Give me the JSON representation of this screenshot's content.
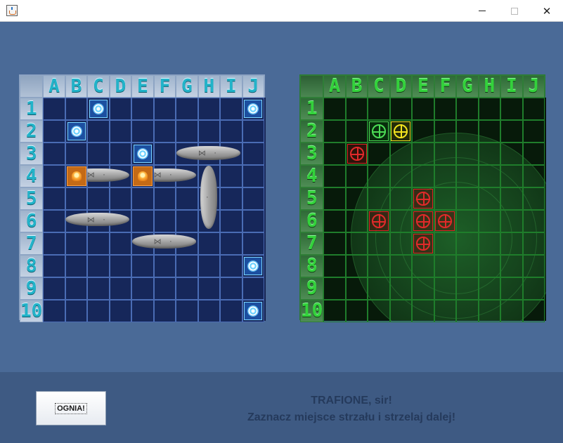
{
  "window": {
    "title": "",
    "icon": "java-cup-icon",
    "controls": {
      "minimize": "—",
      "maximize": "☐",
      "close": "✕"
    }
  },
  "player_board": {
    "columns": [
      "A",
      "B",
      "C",
      "D",
      "E",
      "F",
      "G",
      "H",
      "I",
      "J"
    ],
    "rows": [
      "1",
      "2",
      "3",
      "4",
      "5",
      "6",
      "7",
      "8",
      "9",
      "10"
    ],
    "misses": [
      {
        "col": "C",
        "row": 1
      },
      {
        "col": "J",
        "row": 1
      },
      {
        "col": "B",
        "row": 2
      },
      {
        "col": "E",
        "row": 3
      },
      {
        "col": "J",
        "row": 8
      },
      {
        "col": "J",
        "row": 10
      }
    ],
    "hits": [
      {
        "col": "B",
        "row": 4
      },
      {
        "col": "E",
        "row": 4
      }
    ],
    "ships": [
      {
        "start": "G3",
        "end": "I3",
        "orientation": "horizontal",
        "length": 3
      },
      {
        "start": "B4",
        "end": "D4",
        "orientation": "horizontal",
        "length": 3
      },
      {
        "start": "E4",
        "end": "G4",
        "orientation": "horizontal",
        "length": 3
      },
      {
        "start": "H4",
        "end": "H6",
        "orientation": "vertical",
        "length": 3
      },
      {
        "start": "B6",
        "end": "D6",
        "orientation": "horizontal",
        "length": 3
      },
      {
        "start": "E7",
        "end": "G7",
        "orientation": "horizontal",
        "length": 3
      }
    ]
  },
  "enemy_board": {
    "columns": [
      "A",
      "B",
      "C",
      "D",
      "E",
      "F",
      "G",
      "H",
      "I",
      "J"
    ],
    "rows": [
      "1",
      "2",
      "3",
      "4",
      "5",
      "6",
      "7",
      "8",
      "9",
      "10"
    ],
    "shots": [
      {
        "col": "C",
        "row": 2,
        "state": "green"
      },
      {
        "col": "D",
        "row": 2,
        "state": "yellow"
      },
      {
        "col": "B",
        "row": 3,
        "state": "red"
      },
      {
        "col": "E",
        "row": 5,
        "state": "red"
      },
      {
        "col": "C",
        "row": 6,
        "state": "red"
      },
      {
        "col": "E",
        "row": 6,
        "state": "red"
      },
      {
        "col": "F",
        "row": 6,
        "state": "red"
      },
      {
        "col": "E",
        "row": 7,
        "state": "red"
      }
    ]
  },
  "controls": {
    "fire_label": "OGNIA!"
  },
  "status": {
    "line1": "TRAFIONE, sir!",
    "line2": "Zaznacz miejsce strzału i strzelaj dalej!"
  },
  "colors": {
    "background": "#4a6a97",
    "bottom_panel": "#3e5a83",
    "player_header_text": "#22b3c9",
    "enemy_header_text": "#33d23b",
    "hit": "#c46a16",
    "reticle_red": "#e02a2a",
    "reticle_green": "#4cdc55",
    "reticle_yellow": "#f2e31f"
  }
}
